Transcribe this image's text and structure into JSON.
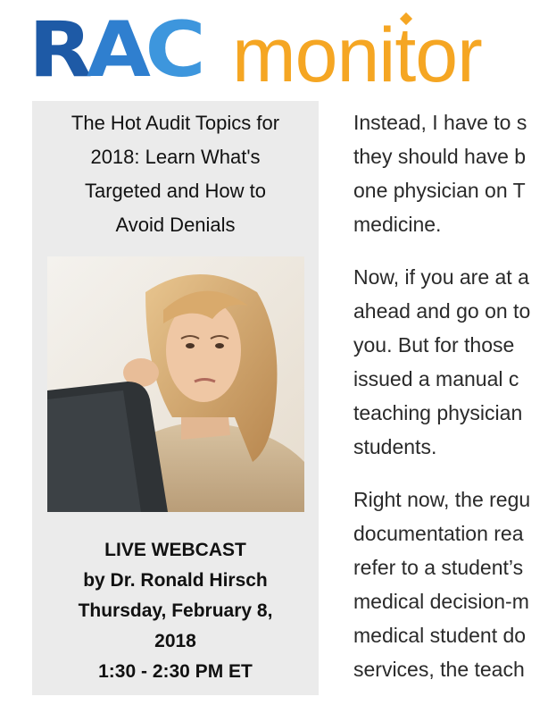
{
  "logo": {
    "rac_letters": [
      "R",
      "A",
      "C"
    ],
    "monitor": "monitor",
    "colors": {
      "rac_dark": "#1e5aa6",
      "rac_mid": "#2f7fcf",
      "rac_light": "#3d96dd",
      "monitor": "#f5a623"
    }
  },
  "ad": {
    "title_lines": [
      "The Hot Audit Topics for",
      "2018: Learn What's",
      "Targeted and How to",
      "Avoid Denials"
    ],
    "info_lines": [
      "LIVE WEBCAST",
      "by Dr. Ronald Hirsch",
      "Thursday, February 8,",
      "2018",
      "1:30 - 2:30 PM ET"
    ],
    "background": "#ebebeb"
  },
  "article": {
    "paragraphs": [
      [
        "Instead, I have to s",
        "they should have b",
        "one physician on T",
        "medicine."
      ],
      [
        "Now, if you are at a",
        "ahead and go on to",
        "you. But for those",
        "issued a manual c",
        "teaching physician",
        "students."
      ],
      [
        "Right now, the regu",
        "documentation rea",
        "refer to a student’s",
        "medical decision-m",
        "medical student do",
        "services, the teach"
      ]
    ]
  }
}
